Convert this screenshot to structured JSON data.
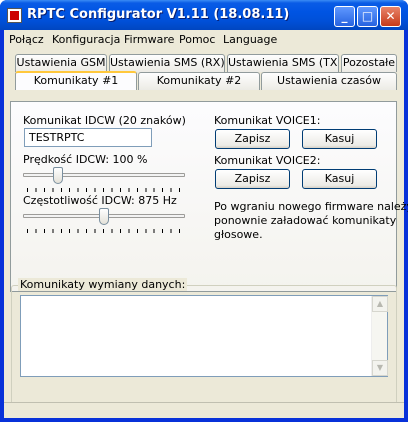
{
  "window": {
    "title": "RPTC Configurator V1.11 (18.08.11)"
  },
  "titlebar_buttons": {
    "minimize": "_",
    "maximize": "□",
    "close": "✕"
  },
  "menu": [
    "Połącz",
    "Konfiguracja",
    "Firmware",
    "Pomoc",
    "Language"
  ],
  "tabs": {
    "row1": [
      "Ustawienia GSM",
      "Ustawienia SMS (RX)",
      "Ustawienia SMS (TX)",
      "Pozostałe"
    ],
    "row2": [
      "Komunikaty #1",
      "Komunikaty #2",
      "Ustawienia czasów"
    ],
    "active": "Komunikaty #1"
  },
  "idcw": {
    "message_label": "Komunikat IDCW (20 znaków)",
    "message_value": "TESTRPTC",
    "speed_label": "Prędkość IDCW: 100 %",
    "speed_level": 0.2,
    "freq_label": "Częstotliwość IDCW: 875 Hz",
    "freq_level": 0.5
  },
  "voice1": {
    "label": "Komunikat VOICE1:",
    "save": "Zapisz",
    "delete": "Kasuj"
  },
  "voice2": {
    "label": "Komunikat VOICE2:",
    "save": "Zapisz",
    "delete": "Kasuj"
  },
  "note": [
    "Po wgraniu nowego firmware należy",
    "ponownie załadować komunikaty",
    "głosowe."
  ],
  "log": {
    "legend": "Komunikaty wymiany danych:",
    "content": ""
  },
  "scroll": {
    "up": "▲",
    "down": "▼"
  }
}
